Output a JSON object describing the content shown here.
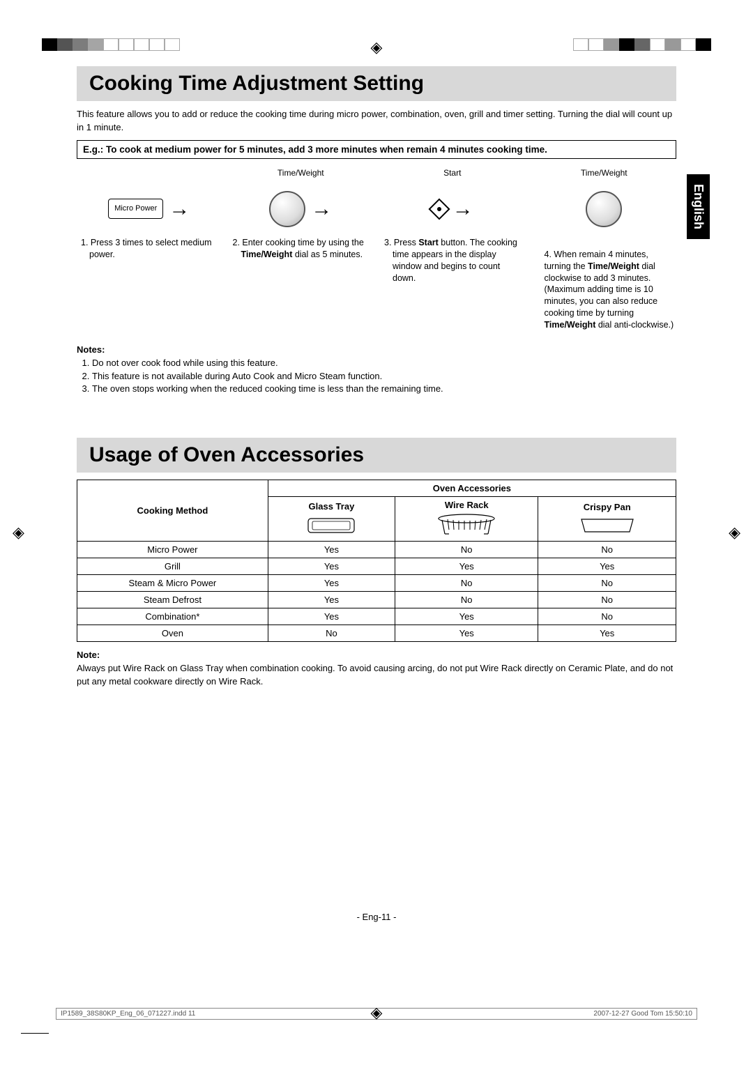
{
  "crop_colors_left": [
    "#000",
    "#545454",
    "#7e7e7e",
    "#a7a7a7",
    "#fff",
    "#fff",
    "#fff",
    "#fff",
    "#fff"
  ],
  "crop_colors_right": [
    "#fff",
    "#fff",
    "#999",
    "#000",
    "#666",
    "#fff",
    "#999",
    "#fff",
    "#000"
  ],
  "language_tab": "English",
  "section1": {
    "title": "Cooking Time Adjustment Setting",
    "intro": "This feature allows you to add or reduce the cooking time during micro power, combination, oven, grill and timer setting. Turning the dial will count up in 1 minute.",
    "example": "E.g.: To cook at medium power for 5 minutes, add 3 more minutes when remain 4 minutes cooking time.",
    "steps": [
      {
        "caption": "",
        "button_label": "Micro Power",
        "text_prefix": "1. Press 3 times to select medium power."
      },
      {
        "caption": "Time/Weight",
        "text_prefix": "2. Enter cooking time by using the ",
        "bold1": "Time/Weight",
        "text_suffix": " dial as 5 minutes."
      },
      {
        "caption": "Start",
        "text_prefix": "3. Press ",
        "bold1": "Start",
        "text_mid": " button. The cooking time appears in the display window and begins to count down."
      },
      {
        "caption": "Time/Weight",
        "text_prefix": "4. When remain 4 minutes, turning the ",
        "bold1": "Time/Weight",
        "text_mid": " dial clockwise to add 3 minutes.\n(Maximum adding time is 10 minutes, you can also reduce cooking time by turning ",
        "bold2": "Time/Weight",
        "text_suffix": " dial anti-clockwise.)"
      }
    ],
    "notes_title": "Notes:",
    "notes": [
      "Do not over cook food while using this feature.",
      "This feature is not available during Auto Cook and Micro Steam function.",
      "The oven stops working when the reduced cooking time is less than the remaining time."
    ]
  },
  "section2": {
    "title": "Usage of Oven Accessories",
    "table": {
      "header_group": "Oven Accessories",
      "row_header": "Cooking Method",
      "columns": [
        "Glass Tray",
        "Wire Rack",
        "Crispy Pan"
      ],
      "rows": [
        {
          "method": "Micro Power",
          "vals": [
            "Yes",
            "No",
            "No"
          ]
        },
        {
          "method": "Grill",
          "vals": [
            "Yes",
            "Yes",
            "Yes"
          ]
        },
        {
          "method": "Steam & Micro Power",
          "vals": [
            "Yes",
            "No",
            "No"
          ]
        },
        {
          "method": "Steam Defrost",
          "vals": [
            "Yes",
            "No",
            "No"
          ]
        },
        {
          "method": "Combination*",
          "vals": [
            "Yes",
            "Yes",
            "No"
          ]
        },
        {
          "method": "Oven",
          "vals": [
            "No",
            "Yes",
            "Yes"
          ]
        }
      ]
    },
    "note_title": "Note:",
    "note_text": "Always put Wire Rack on Glass Tray when combination cooking. To avoid causing arcing, do not put Wire Rack directly on Ceramic Plate, and do not put any metal cookware directly on Wire Rack."
  },
  "page_number": "- Eng-11 -",
  "print_left": "IP1589_38S80KP_Eng_06_071227.indd   11",
  "print_right": "2007-12-27   Good Tom 15:50:10"
}
